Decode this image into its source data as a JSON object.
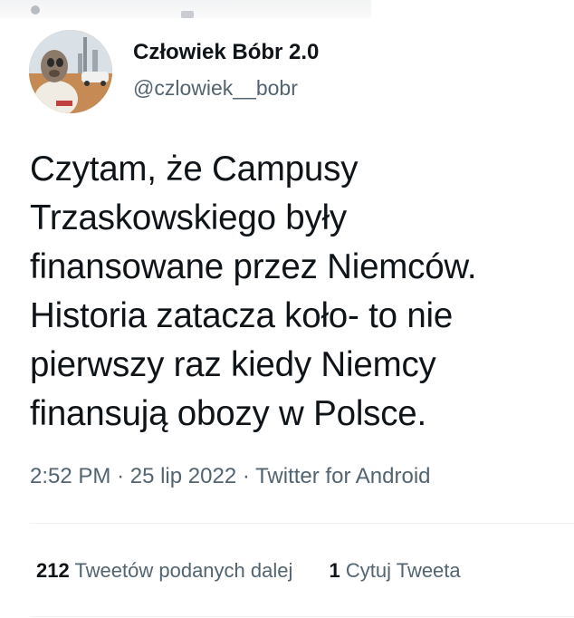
{
  "author": {
    "display_name": "Człowiek Bóbr 2.0",
    "handle": "@czlowiek__bobr"
  },
  "tweet": {
    "text": "Czytam, że Campusy\nTrzaskowskiego były\nfinansowane przez Niemców.\nHistoria zatacza koło- to nie\npierwszy raz kiedy Niemcy\nfinansują obozy w Polsce.",
    "time": "2:52 PM",
    "separator": "·",
    "date": "25 lip 2022",
    "source": "Twitter for Android"
  },
  "stats": {
    "retweets": {
      "count": "212",
      "label": "Tweetów podanych dalej"
    },
    "quotes": {
      "count": "1",
      "label": "Cytuj Tweeta"
    }
  },
  "colors": {
    "text": "#0f1419",
    "secondary": "#536471",
    "divider": "#eff3f4"
  }
}
